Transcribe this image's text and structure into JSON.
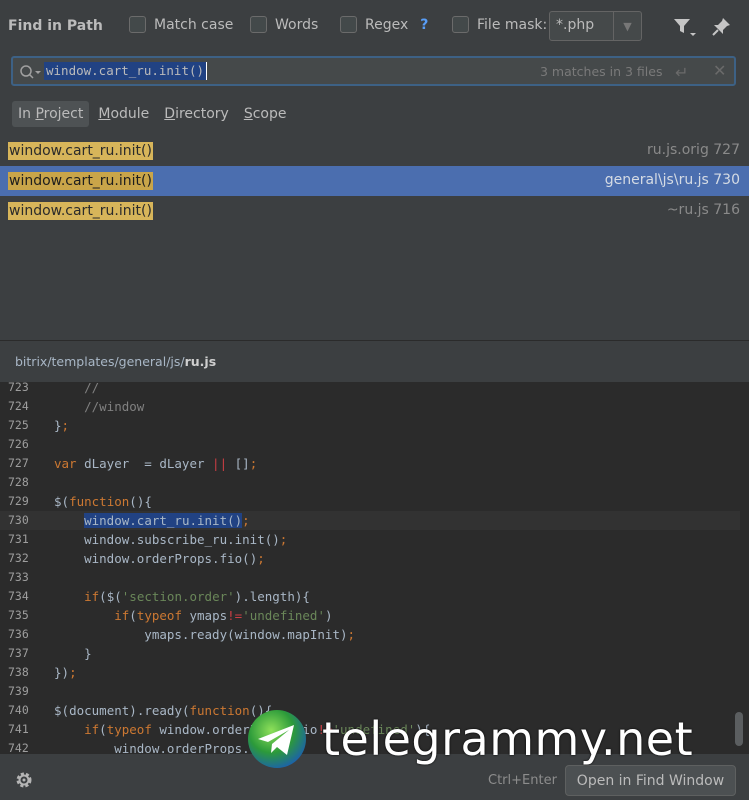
{
  "header": {
    "title": "Find in Path",
    "options": [
      {
        "label": "Match case"
      },
      {
        "label": "Words"
      },
      {
        "label": "Regex"
      },
      {
        "label": "File mask:"
      }
    ],
    "regex_help": "?",
    "file_mask_value": "*.php"
  },
  "search": {
    "query": "window.cart_ru.init()",
    "match_count": "3 matches in 3 files"
  },
  "scopes": [
    {
      "label": "In Project",
      "active": true
    },
    {
      "label": "Module"
    },
    {
      "label": "Directory"
    },
    {
      "label": "Scope"
    }
  ],
  "results": [
    {
      "code": "window.cart_ru.init()",
      "suffix": ";",
      "location": "ru.js.orig 727",
      "selected": false
    },
    {
      "code": "window.cart_ru.init()",
      "suffix": ";",
      "location": "general\\js\\ru.js 730",
      "selected": true
    },
    {
      "code": "window.cart_ru.init()",
      "suffix": ";",
      "location": "~ru.js 716",
      "selected": false
    }
  ],
  "preview": {
    "path_prefix": "bitrix/templates/general/js/",
    "file_name": "ru.js",
    "lines": [
      {
        "n": "723",
        "text": "    //"
      },
      {
        "n": "724",
        "text": "    //window"
      },
      {
        "n": "725",
        "text": "};"
      },
      {
        "n": "726",
        "text": ""
      },
      {
        "n": "727",
        "text": "var dLayer  = dLayer || [];"
      },
      {
        "n": "728",
        "text": ""
      },
      {
        "n": "729",
        "text": "$(function(){"
      },
      {
        "n": "730",
        "text": "    window.cart_ru.init();"
      },
      {
        "n": "731",
        "text": "    window.subscribe_ru.init();"
      },
      {
        "n": "732",
        "text": "    window.orderProps.fio();"
      },
      {
        "n": "733",
        "text": ""
      },
      {
        "n": "734",
        "text": "    if($('section.order').length){"
      },
      {
        "n": "735",
        "text": "        if(typeof ymaps!='undefined')"
      },
      {
        "n": "736",
        "text": "            ymaps.ready(window.mapInit);"
      },
      {
        "n": "737",
        "text": "    }"
      },
      {
        "n": "738",
        "text": "});"
      },
      {
        "n": "739",
        "text": ""
      },
      {
        "n": "740",
        "text": "$(document).ready(function(){"
      },
      {
        "n": "741",
        "text": "    if(typeof window.orderProps.fio!='undefined'){"
      },
      {
        "n": "742",
        "text": "        window.orderProps.fio();"
      }
    ]
  },
  "footer": {
    "shortcut": "Ctrl+Enter",
    "open_button": "Open in Find Window"
  },
  "watermark": "telegrammy.net",
  "colors": {
    "background": "#3c3f41",
    "editor_bg": "#2b2b2b",
    "selection": "#4b6eaf",
    "match_highlight": "#d7b55a",
    "keyword": "#cc7832",
    "string": "#6a8759",
    "comment": "#808080"
  }
}
